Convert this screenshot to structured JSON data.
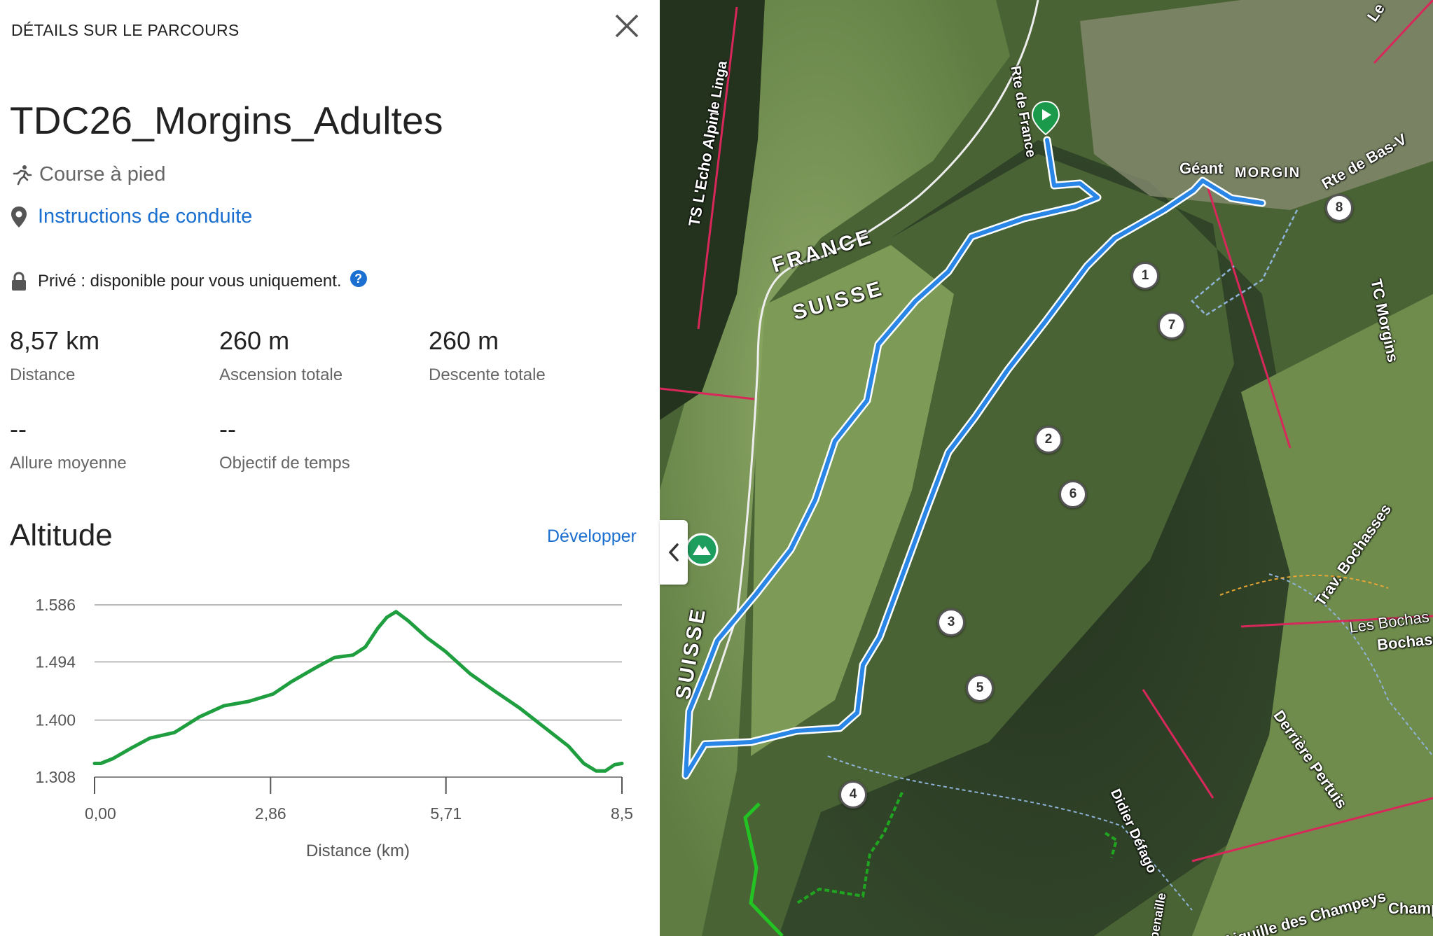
{
  "panel": {
    "header": "DÉTAILS SUR LE PARCOURS",
    "title": "TDC26_Morgins_Adultes",
    "activity": "Course à pied",
    "driving_link": "Instructions de conduite",
    "privacy": "Privé : disponible pour vous uniquement.",
    "help_glyph": "?"
  },
  "stats": [
    {
      "value": "8,57 km",
      "label": "Distance"
    },
    {
      "value": "260 m",
      "label": "Ascension totale"
    },
    {
      "value": "260 m",
      "label": "Descente totale"
    },
    {
      "value": "--",
      "label": "Allure moyenne"
    },
    {
      "value": "--",
      "label": "Objectif de temps"
    }
  ],
  "altitude": {
    "heading": "Altitude",
    "expand_link": "Développer"
  },
  "chart_data": {
    "type": "line",
    "xlabel": "Distance (km)",
    "ylabel": "",
    "ytick_labels": [
      "1.586",
      "1.494",
      "1.400",
      "1.308"
    ],
    "yticks": [
      1586,
      1494,
      1400,
      1308
    ],
    "xtick_labels": [
      "0,00",
      "2,86",
      "5,71",
      "8,5"
    ],
    "xticks": [
      0,
      2.86,
      5.71,
      8.57
    ],
    "xlim": [
      0,
      8.57
    ],
    "ylim": [
      1308,
      1586
    ],
    "grid": true,
    "color": "#1e9e3e",
    "series": [
      {
        "x": [
          0,
          0.1,
          0.3,
          0.6,
          0.9,
          1.3,
          1.7,
          2.1,
          2.5,
          2.9,
          3.2,
          3.6,
          3.9,
          4.2,
          4.4,
          4.6,
          4.75,
          4.9,
          5.1,
          5.4,
          5.7,
          6.1,
          6.5,
          6.9,
          7.3,
          7.7,
          7.95,
          8.15,
          8.3,
          8.45,
          8.57
        ],
        "y": [
          1330,
          1330,
          1338,
          1355,
          1371,
          1380,
          1405,
          1423,
          1430,
          1442,
          1462,
          1485,
          1501,
          1505,
          1518,
          1548,
          1566,
          1575,
          1560,
          1533,
          1511,
          1475,
          1447,
          1420,
          1389,
          1358,
          1330,
          1318,
          1318,
          1328,
          1330
        ]
      }
    ]
  },
  "map": {
    "labels": [
      "FRANCE",
      "SUISSE",
      "SUISSE",
      "TS L'Echo Alpin",
      "le Linga",
      "Rte de France",
      "Géant",
      "MORGIN",
      "Rte de Bas-V",
      "TC Morgins",
      "Trav. Bochasses",
      "Les Bochas",
      "Bochass",
      "Derrière Pertuis",
      "Didier Défago",
      "Aiguille des Champeys",
      "Champ",
      "Le",
      "penaille"
    ],
    "waypoints": [
      "1",
      "2",
      "3",
      "4",
      "5",
      "6",
      "7",
      "8"
    ],
    "start_icon": "start-flag-icon",
    "poi_icon": "mountain-icon",
    "collapse_icon": "chevron-left-icon"
  },
  "colors": {
    "accent": "#1a6fd0",
    "route": "#2a86e6",
    "chart_line": "#1e9e3e",
    "lift_line": "#d8275a",
    "start_marker": "#1a9a4a"
  }
}
